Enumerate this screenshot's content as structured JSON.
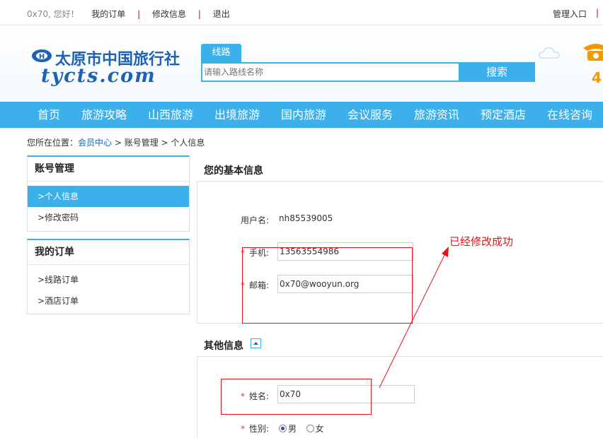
{
  "topbar": {
    "greeting": "0x70, 您好！",
    "my_orders": "我的订单",
    "edit_info": "修改信息",
    "logout": "退出",
    "separator": "|",
    "admin": "管理入口"
  },
  "header": {
    "logo_cn": "太原市中国旅行社",
    "logo_en": "tycts.com",
    "search_tab": "线路",
    "search_placeholder": "请输入路线名称",
    "search_button": "搜索",
    "phone_partial": "4"
  },
  "nav": [
    "首页",
    "旅游攻略",
    "山西旅游",
    "出境旅游",
    "国内旅游",
    "会议服务",
    "旅游资讯",
    "预定酒店",
    "在线咨询"
  ],
  "breadcrumb": {
    "prefix": "您所在位置：",
    "member_center": "会员中心",
    "sep": " > ",
    "account": "账号管理",
    "current": "个人信息"
  },
  "sidebar": {
    "account": {
      "title": "账号管理",
      "items": [
        ">个人信息",
        ">修改密码"
      ]
    },
    "orders": {
      "title": "我的订单",
      "items": [
        ">线路订单",
        ">酒店订单"
      ]
    }
  },
  "basic_info": {
    "title": "您的基本信息",
    "username_label": "用户名:",
    "username_value": "nh85539005",
    "required_mark": "*",
    "phone_label": "手机:",
    "phone_value": "13563554986",
    "email_label": "邮箱:",
    "email_value": "0x70@wooyun.org"
  },
  "other_info": {
    "title": "其他信息",
    "name_label": "姓名:",
    "name_value": "0x70",
    "gender_label": "性别:",
    "gender_options": [
      "男",
      "女"
    ],
    "gender_selected": "男"
  },
  "annotation": {
    "text": "已经修改成功",
    "color": "#e8131a"
  },
  "colors": {
    "accent": "#3cb0ea",
    "brand": "#1d62b5",
    "separator": "#c0003b",
    "phone": "#f39800"
  }
}
